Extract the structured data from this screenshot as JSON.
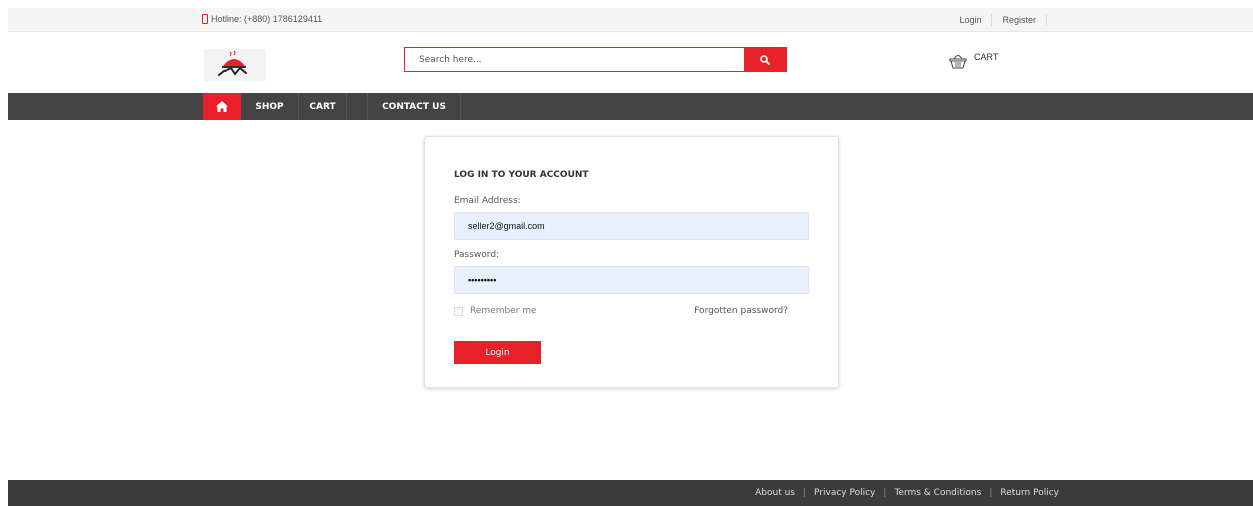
{
  "topbar": {
    "hotline": "Hotline: (+880) 1786129411",
    "login": "Login",
    "register": "Register"
  },
  "header": {
    "search_placeholder": "Search here...",
    "cart_label": "CART"
  },
  "nav": {
    "items": [
      {
        "label": "SHOP"
      },
      {
        "label": "CART"
      },
      {
        "label": "CONTACT US"
      }
    ]
  },
  "login_form": {
    "title": "LOG IN TO YOUR ACCOUNT",
    "email_label": "Email Address:",
    "email_value": "seller2@gmail.com",
    "password_label": "Password:",
    "password_value": "•••••••••",
    "remember_label": "Remember me",
    "forgot_label": "Forgotten password?",
    "submit_label": "Login"
  },
  "footer": {
    "links": [
      "About us",
      "Privacy Policy",
      "Terms & Conditions",
      "Return Policy"
    ]
  },
  "colors": {
    "accent": "#e8202a",
    "nav_bg": "#444444",
    "footer_bg": "#3b3b3b",
    "field_bg": "#e8f0fe"
  },
  "icons": {
    "hotline": "phone-icon",
    "search": "search-icon",
    "cart": "basket-icon",
    "home": "home-icon"
  }
}
